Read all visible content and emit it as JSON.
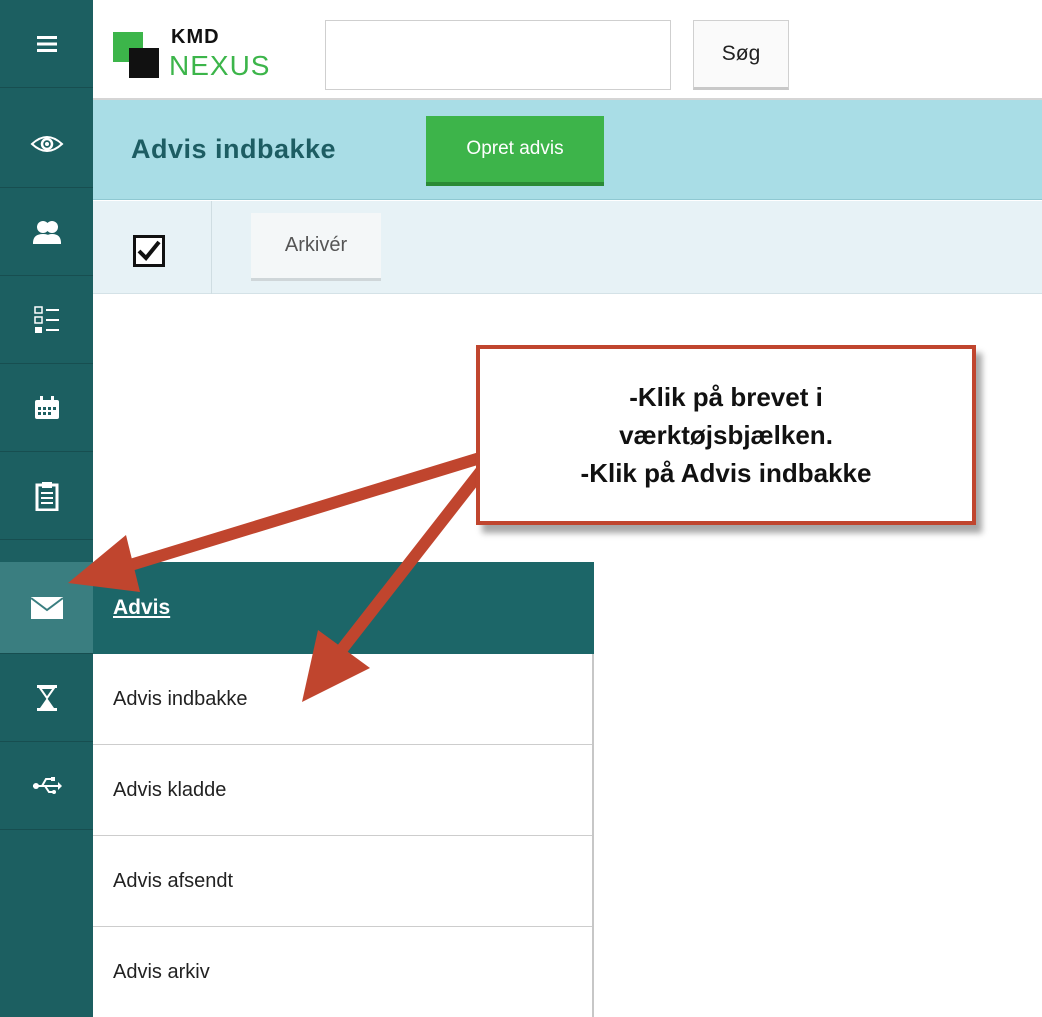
{
  "header": {
    "logo_top": "KMD",
    "logo_bottom": "NEXUS",
    "search": {
      "value": "",
      "placeholder": ""
    },
    "search_button": "Søg"
  },
  "page": {
    "title": "Advis indbakke",
    "create_button": "Opret advis"
  },
  "toolbar": {
    "select_all_checked": true,
    "archive_button": "Arkivér"
  },
  "rail": {
    "items": [
      {
        "icon": "hamburger-menu-icon"
      },
      {
        "icon": "eye-icon"
      },
      {
        "icon": "citizens-icon"
      },
      {
        "icon": "checklist-icon"
      },
      {
        "icon": "calendar-icon"
      },
      {
        "icon": "clipboard-icon"
      },
      {
        "icon": "envelope-icon",
        "active": true
      },
      {
        "icon": "hourglass-icon"
      },
      {
        "icon": "usb-icon"
      }
    ]
  },
  "menu": {
    "header": "Advis",
    "items": [
      {
        "label": "Advis indbakke"
      },
      {
        "label": "Advis kladde"
      },
      {
        "label": "Advis afsendt"
      },
      {
        "label": "Advis arkiv"
      }
    ]
  },
  "annotation": {
    "lines": [
      "-Klik på brevet i",
      "værktøjsbjælken.",
      "-Klik på Advis indbakke"
    ]
  },
  "colors": {
    "rail": "#1c5f61",
    "title_bar": "#a9dde6",
    "accent_green": "#3db44a",
    "annotation_red": "#c0452e"
  }
}
